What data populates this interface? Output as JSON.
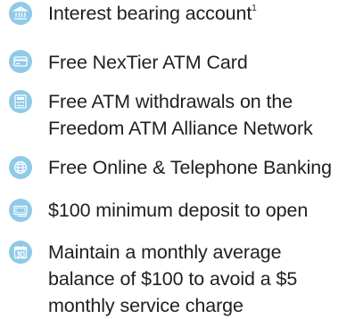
{
  "colors": {
    "icon_circle": "#8fcbe8",
    "icon_glyph": "#ffffff",
    "text": "#1f1f1f"
  },
  "features": [
    {
      "icon": "bank-icon",
      "text": "Interest bearing account",
      "footnote": "1"
    },
    {
      "icon": "credit-card-icon",
      "text": "Free NexTier ATM Card"
    },
    {
      "icon": "atm-machine-icon",
      "lines": [
        "Free ATM withdrawals on the",
        "Freedom ATM Alliance Network"
      ]
    },
    {
      "icon": "globe-icon",
      "text": "Free Online & Telephone Banking"
    },
    {
      "icon": "cash-icon",
      "text": "$100 minimum deposit to open"
    },
    {
      "icon": "calendar-icon",
      "lines": [
        "Maintain a monthly average",
        "balance of $100 to avoid a $5",
        "monthly service charge"
      ]
    }
  ]
}
